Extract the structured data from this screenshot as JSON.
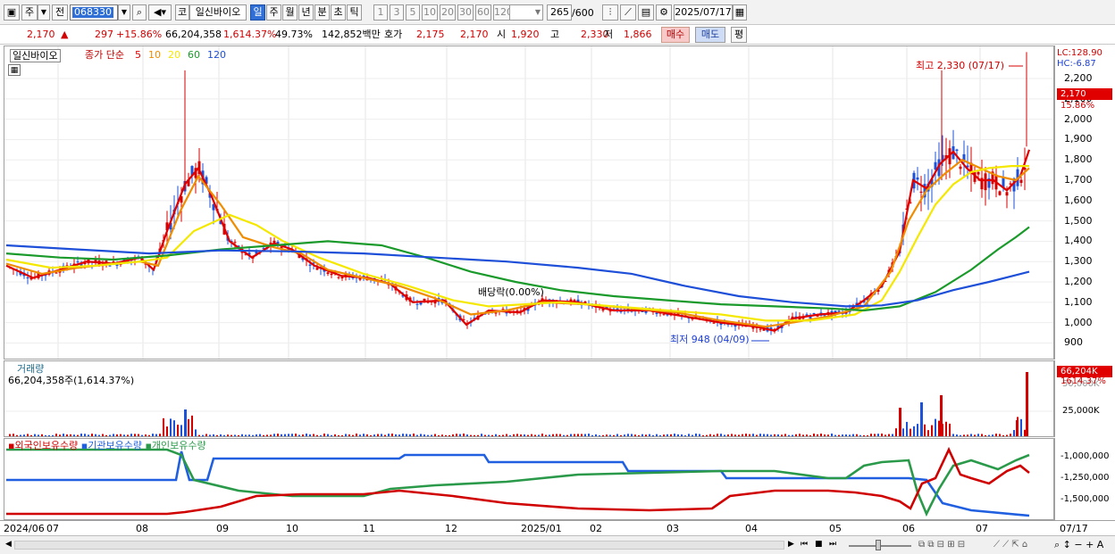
{
  "toolbar": {
    "market": "주",
    "type_label": "전",
    "code": "068330",
    "name_btn": "코",
    "name": "일신바이오",
    "periods": [
      "일",
      "주",
      "월",
      "년",
      "분",
      "초",
      "틱"
    ],
    "period_active": "일",
    "intervals": [
      "1",
      "3",
      "5",
      "10",
      "20",
      "30",
      "60",
      "120"
    ],
    "count": "265",
    "count_total": "/600",
    "date": "2025/07/17"
  },
  "quote": {
    "price": "2,170",
    "arrow": "▲",
    "change": "297",
    "change_pct": "+15.86%",
    "volume": "66,204,358",
    "volume_ratio": "1,614.37%",
    "turnover": "49.73%",
    "amount": "142,852백만",
    "hoga_label": "호가",
    "hoga_ask": "2,175",
    "hoga_bid": "2,170",
    "open_label": "시",
    "open": "1,920",
    "high_label": "고",
    "high": "2,330",
    "low_label": "저",
    "low": "1,866",
    "buy_btn": "매수",
    "sell_btn": "매도",
    "extra_btn": "평"
  },
  "price_panel": {
    "name_tag": "일신바이오",
    "ma_title": "종가 단순",
    "ma_periods": [
      "5",
      "10",
      "20",
      "60",
      "120"
    ],
    "ma_colors": [
      "#e00000",
      "#f08c00",
      "#f5e800",
      "#1a9a2a",
      "#1e4fd8"
    ],
    "high_note": "최고 2,330 (07/17)",
    "low_note": "최저 948 (04/09)",
    "event_note": "배당락(0.00%)",
    "lc_label": "LC:128.90",
    "hc_label": "HC:-6.87",
    "last_price_tag": "2,170",
    "last_pct_tag": "15.86%"
  },
  "volume_panel": {
    "title": "거래량",
    "value": "66,204,358주(1,614.37%)",
    "tag_value": "66,204K",
    "tag_pct": "1614.37%",
    "partial_tick": "50,000K",
    "tick": "25,000K"
  },
  "holding_panel": {
    "series": [
      {
        "name": "외국인보유수량",
        "color": "#d00000"
      },
      {
        "name": "기관보유수량",
        "color": "#2060e0"
      },
      {
        "name": "개인보유수량",
        "color": "#2a9a4a"
      }
    ],
    "ticks": [
      "-1,000,000",
      "-1,250,000",
      "-1,500,000"
    ]
  },
  "x_axis": {
    "labels": [
      "2024/06",
      "07",
      "08",
      "09",
      "10",
      "11",
      "12",
      "2025/01",
      "02",
      "03",
      "04",
      "05",
      "06",
      "07"
    ],
    "right_label": "07/17"
  },
  "chart_data": {
    "type": "line",
    "y_ticks": [
      "2,200",
      "2,100",
      "2,000",
      "1,900",
      "1,800",
      "1,700",
      "1,600",
      "1,500",
      "1,400",
      "1,300",
      "1,200",
      "1,100",
      "1,000",
      "900"
    ],
    "ylim": [
      880,
      2380
    ],
    "series": [
      {
        "name": "5",
        "values": [
          [
            0,
            1280
          ],
          [
            30,
            1220
          ],
          [
            60,
            1260
          ],
          [
            90,
            1300
          ],
          [
            120,
            1290
          ],
          [
            150,
            1320
          ],
          [
            165,
            1260
          ],
          [
            180,
            1450
          ],
          [
            200,
            1680
          ],
          [
            215,
            1760
          ],
          [
            230,
            1620
          ],
          [
            250,
            1400
          ],
          [
            275,
            1320
          ],
          [
            300,
            1390
          ],
          [
            320,
            1360
          ],
          [
            345,
            1280
          ],
          [
            375,
            1230
          ],
          [
            405,
            1220
          ],
          [
            430,
            1190
          ],
          [
            455,
            1100
          ],
          [
            490,
            1110
          ],
          [
            515,
            990
          ],
          [
            540,
            1060
          ],
          [
            575,
            1050
          ],
          [
            600,
            1110
          ],
          [
            640,
            1100
          ],
          [
            680,
            1060
          ],
          [
            720,
            1060
          ],
          [
            760,
            1030
          ],
          [
            800,
            1000
          ],
          [
            840,
            980
          ],
          [
            860,
            960
          ],
          [
            880,
            1020
          ],
          [
            910,
            1040
          ],
          [
            940,
            1050
          ],
          [
            960,
            1110
          ],
          [
            980,
            1180
          ],
          [
            1000,
            1350
          ],
          [
            1015,
            1700
          ],
          [
            1030,
            1660
          ],
          [
            1045,
            1780
          ],
          [
            1060,
            1840
          ],
          [
            1075,
            1760
          ],
          [
            1090,
            1700
          ],
          [
            1105,
            1700
          ],
          [
            1120,
            1650
          ],
          [
            1135,
            1720
          ],
          [
            1145,
            1850
          ]
        ]
      },
      {
        "name": "10",
        "values": [
          [
            0,
            1290
          ],
          [
            40,
            1240
          ],
          [
            80,
            1270
          ],
          [
            120,
            1290
          ],
          [
            150,
            1300
          ],
          [
            170,
            1280
          ],
          [
            195,
            1550
          ],
          [
            215,
            1720
          ],
          [
            240,
            1580
          ],
          [
            265,
            1420
          ],
          [
            300,
            1370
          ],
          [
            330,
            1340
          ],
          [
            360,
            1260
          ],
          [
            400,
            1220
          ],
          [
            440,
            1180
          ],
          [
            480,
            1120
          ],
          [
            520,
            1040
          ],
          [
            560,
            1060
          ],
          [
            600,
            1100
          ],
          [
            650,
            1090
          ],
          [
            700,
            1070
          ],
          [
            750,
            1050
          ],
          [
            800,
            1010
          ],
          [
            850,
            980
          ],
          [
            880,
            1000
          ],
          [
            920,
            1030
          ],
          [
            960,
            1080
          ],
          [
            990,
            1250
          ],
          [
            1010,
            1500
          ],
          [
            1030,
            1650
          ],
          [
            1050,
            1730
          ],
          [
            1070,
            1800
          ],
          [
            1090,
            1760
          ],
          [
            1110,
            1720
          ],
          [
            1130,
            1700
          ],
          [
            1145,
            1760
          ]
        ]
      },
      {
        "name": "20",
        "values": [
          [
            0,
            1310
          ],
          [
            50,
            1270
          ],
          [
            100,
            1280
          ],
          [
            150,
            1300
          ],
          [
            180,
            1320
          ],
          [
            210,
            1450
          ],
          [
            250,
            1530
          ],
          [
            280,
            1480
          ],
          [
            310,
            1400
          ],
          [
            350,
            1320
          ],
          [
            400,
            1240
          ],
          [
            450,
            1180
          ],
          [
            500,
            1110
          ],
          [
            540,
            1080
          ],
          [
            580,
            1090
          ],
          [
            620,
            1100
          ],
          [
            680,
            1080
          ],
          [
            740,
            1060
          ],
          [
            800,
            1040
          ],
          [
            850,
            1010
          ],
          [
            900,
            1010
          ],
          [
            950,
            1040
          ],
          [
            980,
            1110
          ],
          [
            1000,
            1250
          ],
          [
            1020,
            1420
          ],
          [
            1040,
            1580
          ],
          [
            1060,
            1680
          ],
          [
            1080,
            1740
          ],
          [
            1100,
            1760
          ],
          [
            1125,
            1770
          ],
          [
            1145,
            1770
          ]
        ]
      },
      {
        "name": "60",
        "values": [
          [
            0,
            1340
          ],
          [
            60,
            1320
          ],
          [
            120,
            1310
          ],
          [
            180,
            1330
          ],
          [
            240,
            1360
          ],
          [
            300,
            1380
          ],
          [
            360,
            1400
          ],
          [
            420,
            1380
          ],
          [
            470,
            1320
          ],
          [
            520,
            1250
          ],
          [
            570,
            1200
          ],
          [
            620,
            1160
          ],
          [
            680,
            1130
          ],
          [
            740,
            1110
          ],
          [
            800,
            1090
          ],
          [
            860,
            1080
          ],
          [
            920,
            1070
          ],
          [
            960,
            1060
          ],
          [
            1000,
            1080
          ],
          [
            1040,
            1150
          ],
          [
            1080,
            1260
          ],
          [
            1110,
            1360
          ],
          [
            1130,
            1420
          ],
          [
            1145,
            1470
          ]
        ]
      },
      {
        "name": "120",
        "values": [
          [
            0,
            1380
          ],
          [
            80,
            1360
          ],
          [
            160,
            1340
          ],
          [
            240,
            1355
          ],
          [
            320,
            1350
          ],
          [
            400,
            1340
          ],
          [
            480,
            1320
          ],
          [
            560,
            1300
          ],
          [
            640,
            1270
          ],
          [
            700,
            1240
          ],
          [
            760,
            1180
          ],
          [
            820,
            1130
          ],
          [
            880,
            1100
          ],
          [
            940,
            1080
          ],
          [
            980,
            1085
          ],
          [
            1020,
            1110
          ],
          [
            1060,
            1160
          ],
          [
            1100,
            1200
          ],
          [
            1145,
            1250
          ]
        ]
      }
    ]
  }
}
